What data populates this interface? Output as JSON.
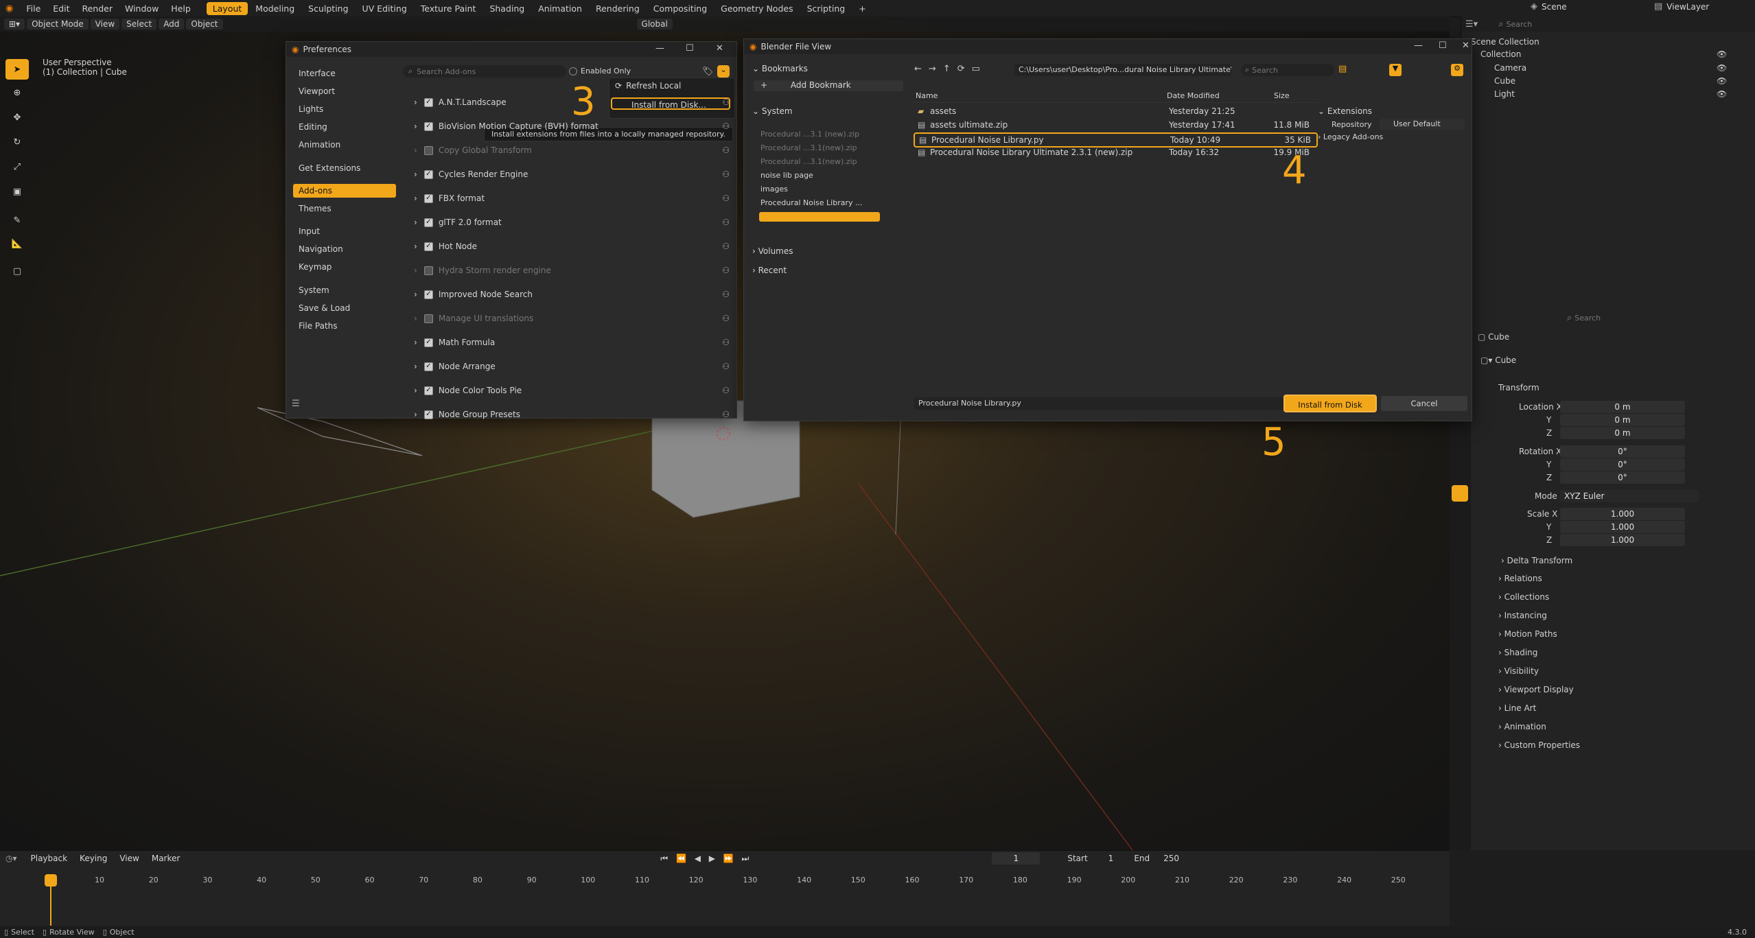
{
  "topbar": {
    "menus": [
      "File",
      "Edit",
      "Render",
      "Window",
      "Help"
    ],
    "workspaces": [
      "Layout",
      "Modeling",
      "Sculpting",
      "UV Editing",
      "Texture Paint",
      "Shading",
      "Animation",
      "Rendering",
      "Compositing",
      "Geometry Nodes",
      "Scripting"
    ],
    "active_workspace": "Layout",
    "scene": "Scene",
    "view_layer": "ViewLayer",
    "search_placeholder": "Search"
  },
  "viewport": {
    "mode": "Object Mode",
    "menus": [
      "View",
      "Select",
      "Add",
      "Object"
    ],
    "transform": "Global",
    "info_line1": "User Perspective",
    "info_line2": "(1) Collection | Cube"
  },
  "preferences": {
    "title": "Preferences",
    "sidebar": [
      "Interface",
      "Viewport",
      "Lights",
      "Editing",
      "Animation",
      "Get Extensions",
      "Add-ons",
      "Themes",
      "Input",
      "Navigation",
      "Keymap",
      "System",
      "Save & Load",
      "File Paths"
    ],
    "active": "Add-ons",
    "search_placeholder": "Search Add-ons",
    "enabled_only": "Enabled Only",
    "dropdown": {
      "refresh": "Refresh Local",
      "install": "Install from Disk..."
    },
    "tooltip": "Install extensions from files into a locally managed repository.",
    "addons": [
      {
        "name": "A.N.T.Landscape",
        "on": true
      },
      {
        "name": "BioVision Motion Capture (BVH) format",
        "on": true
      },
      {
        "name": "Copy Global Transform",
        "on": false
      },
      {
        "name": "Cycles Render Engine",
        "on": true
      },
      {
        "name": "FBX format",
        "on": true
      },
      {
        "name": "glTF 2.0 format",
        "on": true
      },
      {
        "name": "Hot Node",
        "on": true
      },
      {
        "name": "Hydra Storm render engine",
        "on": false
      },
      {
        "name": "Improved Node Search",
        "on": true
      },
      {
        "name": "Manage UI translations",
        "on": false
      },
      {
        "name": "Math Formula",
        "on": true
      },
      {
        "name": "Node Arrange",
        "on": true
      },
      {
        "name": "Node Color Tools Pie",
        "on": true
      },
      {
        "name": "Node Group Presets",
        "on": true
      }
    ]
  },
  "file_browser": {
    "title": "Blender File View",
    "bookmarks_label": "Bookmarks",
    "add_bookmark": "Add Bookmark",
    "system_label": "System",
    "system_items": [
      "Procedural ...3.1 (new).zip",
      "Procedural ...3.1(new).zip",
      "Procedural ...3.1(new).zip",
      "noise lib page",
      "images",
      "Procedural Noise Library ..."
    ],
    "volumes_label": "Volumes",
    "recent_label": "Recent",
    "path": "C:\\Users\\user\\Desktop\\Pro...dural Noise Library Ultimate\\",
    "search_placeholder": "Search",
    "columns": {
      "name": "Name",
      "date": "Date Modified",
      "size": "Size"
    },
    "files": [
      {
        "name": "assets",
        "date": "Yesterday 21:25",
        "size": ""
      },
      {
        "name": "assets ultimate.zip",
        "date": "Yesterday 17:41",
        "size": "11.8 MiB"
      },
      {
        "name": "Procedural Noise Library.py",
        "date": "Today 10:49",
        "size": "35 KiB"
      },
      {
        "name": "Procedural Noise Library Ultimate  2.3.1 (new).zip",
        "date": "Today 16:32",
        "size": "19.9 MiB"
      }
    ],
    "extensions_label": "Extensions",
    "repository_label": "Repository",
    "repository_value": "User Default",
    "legacy_label": "Legacy Add-ons",
    "filename": "Procedural Noise Library.py",
    "install_button": "Install from Disk",
    "cancel_button": "Cancel"
  },
  "steps": {
    "s3": "3",
    "s4": "4",
    "s5": "5"
  },
  "outliner": {
    "title": "Scene Collection",
    "items": [
      "Collection",
      "Camera",
      "Cube",
      "Light"
    ]
  },
  "properties": {
    "search_placeholder": "Search",
    "object_name": "Cube",
    "data_name": "Cube",
    "transform_label": "Transform",
    "location_x": "Location X",
    "rotation_x": "Rotation X",
    "scale_x": "Scale X",
    "y": "Y",
    "z": "Z",
    "loc": [
      "0 m",
      "0 m",
      "0 m"
    ],
    "rot": [
      "0°",
      "0°",
      "0°"
    ],
    "scale": [
      "1.000",
      "1.000",
      "1.000"
    ],
    "mode_label": "Mode",
    "mode_value": "XYZ Euler",
    "delta": "Delta Transform",
    "sections": [
      "Relations",
      "Collections",
      "Instancing",
      "Motion Paths",
      "Shading",
      "Visibility",
      "Viewport Display",
      "Line Art",
      "Animation",
      "Custom Properties"
    ]
  },
  "timeline": {
    "menus": [
      "Playback",
      "Keying",
      "View",
      "Marker"
    ],
    "current_frame": "1",
    "start_label": "Start",
    "start": "1",
    "end_label": "End",
    "end": "250",
    "ticks": [
      "1",
      "10",
      "20",
      "30",
      "40",
      "50",
      "60",
      "70",
      "80",
      "90",
      "100",
      "110",
      "120",
      "130",
      "140",
      "150",
      "160",
      "170",
      "180",
      "190",
      "200",
      "210",
      "220",
      "230",
      "240",
      "250"
    ]
  },
  "status": {
    "select": "Select",
    "rotate": "Rotate View",
    "object": "Object",
    "version": "4.3.0"
  }
}
